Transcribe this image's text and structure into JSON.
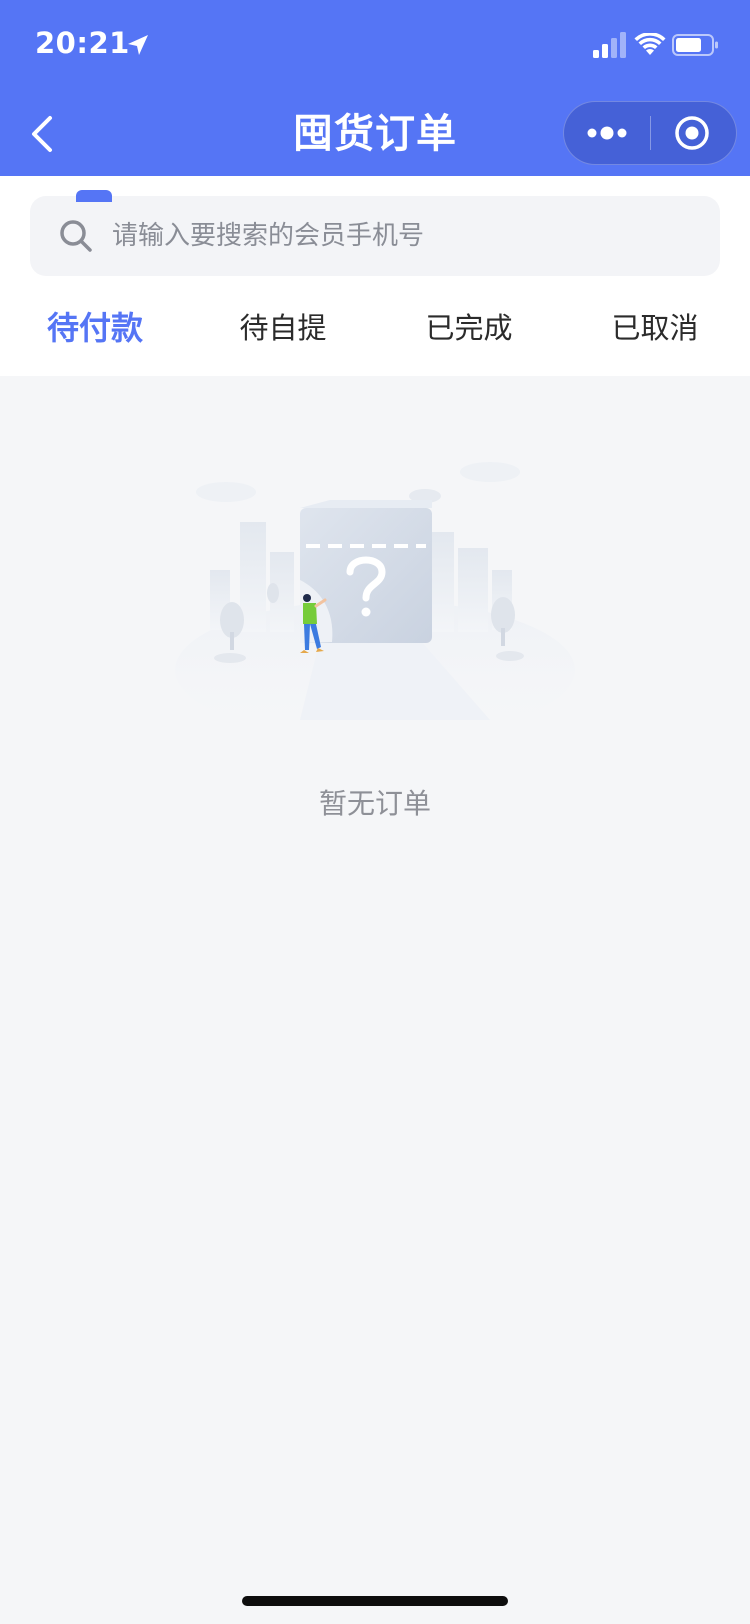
{
  "status_bar": {
    "time": "20:21"
  },
  "navbar": {
    "title": "囤货订单"
  },
  "search": {
    "placeholder": "请输入要搜索的会员手机号"
  },
  "tabs": [
    {
      "label": "待付款",
      "active": true
    },
    {
      "label": "待自提",
      "active": false
    },
    {
      "label": "已完成",
      "active": false
    },
    {
      "label": "已取消",
      "active": false
    }
  ],
  "empty_state": {
    "message": "暂无订单"
  },
  "colors": {
    "primary": "#5575f5",
    "background": "#f5f6f8",
    "text": "#2b2b2b",
    "muted": "#8e9097"
  },
  "icons": {
    "location": "location-arrow-icon",
    "signal": "cellular-signal-icon",
    "wifi": "wifi-icon",
    "battery": "battery-icon",
    "back": "chevron-left-icon",
    "more": "more-dots-icon",
    "close": "target-circle-icon",
    "search": "search-icon"
  }
}
